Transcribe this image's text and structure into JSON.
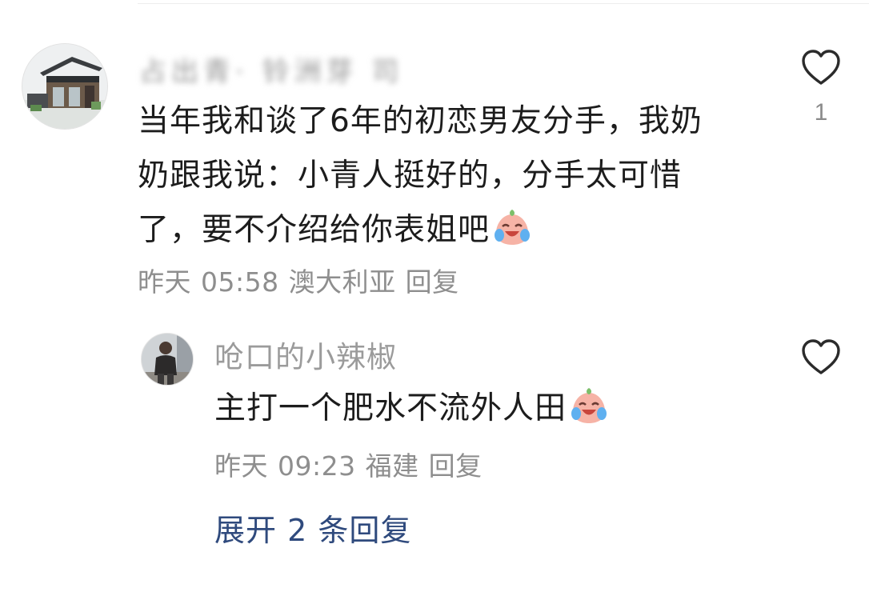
{
  "comment": {
    "username": "占出青· 铃洲芽 司",
    "text_lines": [
      "当年我和谈了6年的初恋男友分手，我奶",
      "奶跟我说：小青人挺好的，分手太可惜",
      "了，要不介绍给你表姐吧"
    ],
    "emoji": "crying-laughing-peach-emoji",
    "date": "昨天",
    "time": "05:58",
    "location": "澳大利亚",
    "reply_label": "回复",
    "like_count": "1"
  },
  "reply": {
    "username": "呛口的小辣椒",
    "text": "主打一个肥水不流外人田",
    "emoji": "crying-laughing-peach-emoji",
    "date": "昨天",
    "time": "09:23",
    "location": "福建",
    "reply_label": "回复"
  },
  "expand": {
    "label": "展开 2 条回复"
  },
  "icons": {
    "like": "heart-outline-icon"
  },
  "colors": {
    "text": "#1c1c1c",
    "meta": "#8e8e8e",
    "link": "#2f4a7d",
    "emoji_face": "#f6b3a6"
  }
}
